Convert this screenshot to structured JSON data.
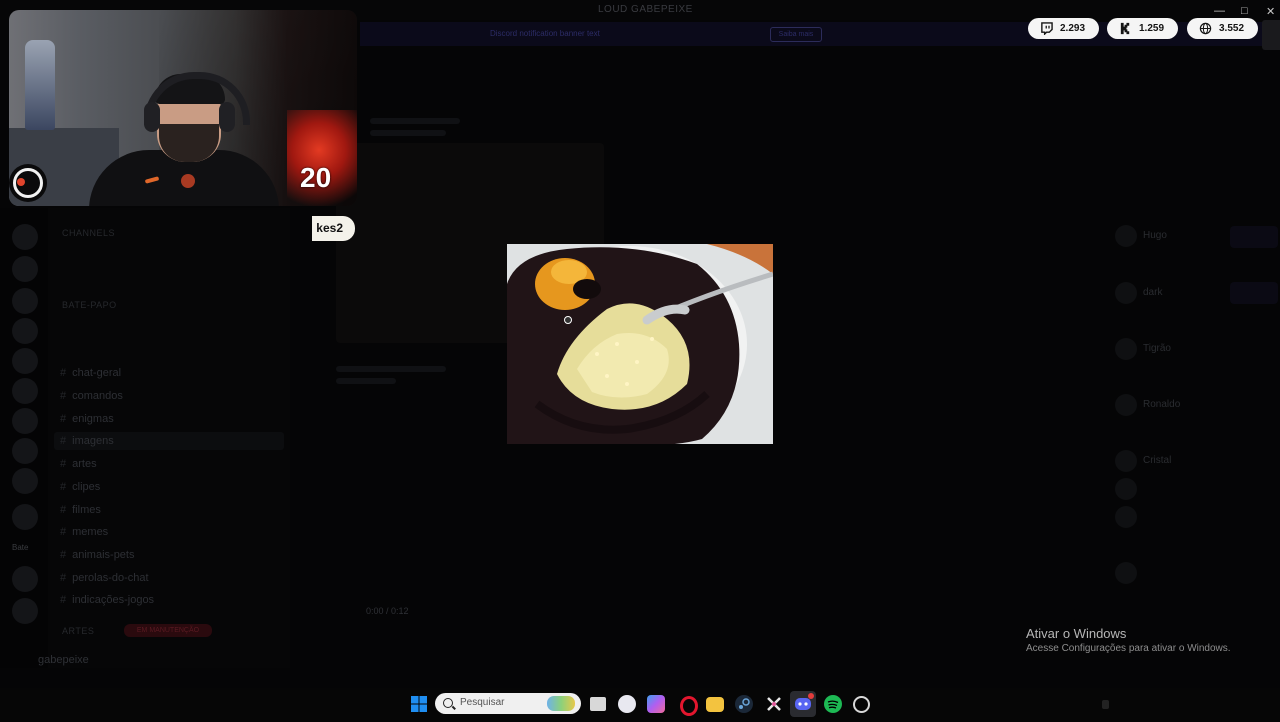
{
  "window": {
    "title": "LOUD GABEPEIXE"
  },
  "banner": {
    "text": "Discord notification banner text",
    "button": "Saiba mais"
  },
  "stats": [
    {
      "icon": "twitch-icon",
      "value": "2.293",
      "color": "#9146ff"
    },
    {
      "icon": "kick-icon",
      "value": "1.259",
      "color": "#111111"
    },
    {
      "icon": "globe-icon",
      "value": "3.552",
      "color": "#111111"
    }
  ],
  "webcam": {
    "counter": "20"
  },
  "chat_user_pill": "kes2",
  "rail": {
    "label": "Bate"
  },
  "channels": {
    "categories": [
      "CHANNELS",
      "BATE-PAPO",
      "ARTES"
    ],
    "items": [
      {
        "name": "chat-geral"
      },
      {
        "name": "comandos"
      },
      {
        "name": "enigmas"
      },
      {
        "name": "imagens"
      },
      {
        "name": "artes"
      },
      {
        "name": "clipes"
      },
      {
        "name": "filmes"
      },
      {
        "name": "memes"
      },
      {
        "name": "animais-pets"
      },
      {
        "name": "perolas-do-chat"
      },
      {
        "name": "indicações-jogos"
      }
    ],
    "tag": "EM MANUTENÇÃO"
  },
  "user_bar": {
    "name": "gabepeixe"
  },
  "media": {
    "time": "0:00 / 0:12"
  },
  "members": [
    {
      "name": "Hugo"
    },
    {
      "name": "dark"
    },
    {
      "name": "Tigrão"
    },
    {
      "name": "Ronaldo"
    },
    {
      "name": "Cristal"
    }
  ],
  "watermark": {
    "title": "Ativar o Windows",
    "subtitle": "Acesse Configurações para ativar o Windows."
  },
  "taskbar": {
    "search_placeholder": "Pesquisar",
    "apps": [
      {
        "name": "windows-start-icon",
        "color": "#1f8ef1"
      },
      {
        "name": "task-view-icon",
        "color": "#d8d8d8"
      },
      {
        "name": "ghost-app-icon",
        "color": "#e8e8f0"
      },
      {
        "name": "copilot-icon",
        "color": "#7b6cf3"
      },
      {
        "name": "opera-icon",
        "color": "#e3162e"
      },
      {
        "name": "file-explorer-icon",
        "color": "#f3c33f"
      },
      {
        "name": "steam-icon",
        "color": "#6aa5d9"
      },
      {
        "name": "capcut-icon",
        "color": "#e9e9e9"
      },
      {
        "name": "discord-icon",
        "color": "#5865f2"
      },
      {
        "name": "spotify-icon",
        "color": "#1db954"
      },
      {
        "name": "obs-icon",
        "color": "#d8d8d8"
      }
    ]
  }
}
